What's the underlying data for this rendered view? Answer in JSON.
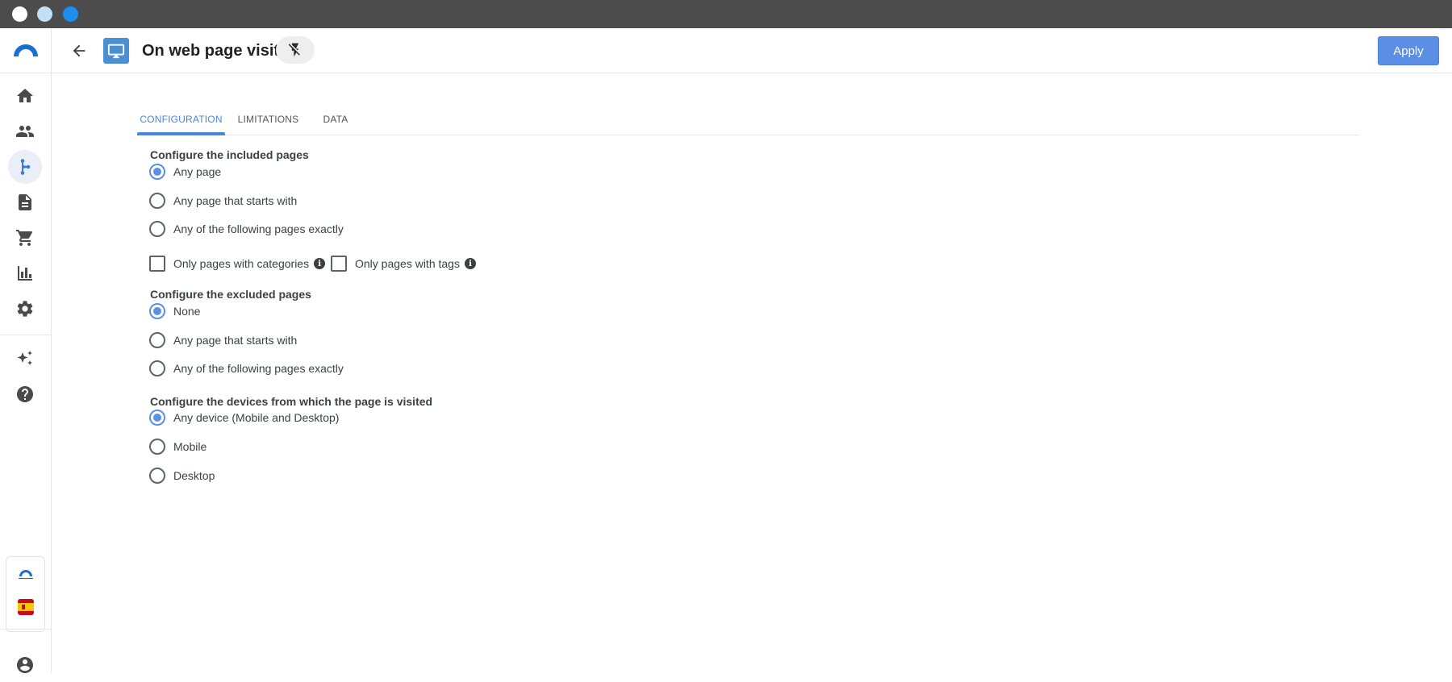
{
  "window": {
    "traffic_colors": [
      "#ffffff",
      "#bfe0f7",
      "#1c8ef0"
    ]
  },
  "sidebar": {
    "items": [
      {
        "name": "home-icon",
        "active": false
      },
      {
        "name": "people-icon",
        "active": false
      },
      {
        "name": "flow-icon",
        "active": true
      },
      {
        "name": "document-icon",
        "active": false
      },
      {
        "name": "cart-icon",
        "active": false
      },
      {
        "name": "chart-icon",
        "active": false
      },
      {
        "name": "gear-icon",
        "active": false
      },
      {
        "name": "sparkle-icon",
        "active": false
      },
      {
        "name": "help-icon",
        "active": false
      }
    ],
    "brand_logo": "connectif-logo-icon",
    "language_flag": "spain-flag-icon",
    "account_icon": "account-circle-icon"
  },
  "header": {
    "title": "On web page visit",
    "back_icon": "arrow-back-icon",
    "page_icon": "monitor-icon",
    "flash_icon": "flash-off-icon",
    "apply_label": "Apply",
    "accent_color": "#5b8fe6"
  },
  "tabs": [
    {
      "label": "CONFIGURATION",
      "active": true
    },
    {
      "label": "LIMITATIONS",
      "active": false
    },
    {
      "label": "DATA",
      "active": false
    }
  ],
  "included": {
    "heading": "Configure the included pages",
    "options": [
      {
        "label": "Any page",
        "checked": true
      },
      {
        "label": "Any page that starts with",
        "checked": false
      },
      {
        "label": "Any of the following pages exactly",
        "checked": false
      }
    ],
    "filters": [
      {
        "label": "Only pages with categories",
        "checked": false
      },
      {
        "label": "Only pages with tags",
        "checked": false
      }
    ]
  },
  "excluded": {
    "heading": "Configure the excluded pages",
    "options": [
      {
        "label": "None",
        "checked": true
      },
      {
        "label": "Any page that starts with",
        "checked": false
      },
      {
        "label": "Any of the following pages exactly",
        "checked": false
      }
    ]
  },
  "devices": {
    "heading": "Configure the devices from which the page is visited",
    "options": [
      {
        "label": "Any device (Mobile and Desktop)",
        "checked": true
      },
      {
        "label": "Mobile",
        "checked": false
      },
      {
        "label": "Desktop",
        "checked": false
      }
    ]
  }
}
